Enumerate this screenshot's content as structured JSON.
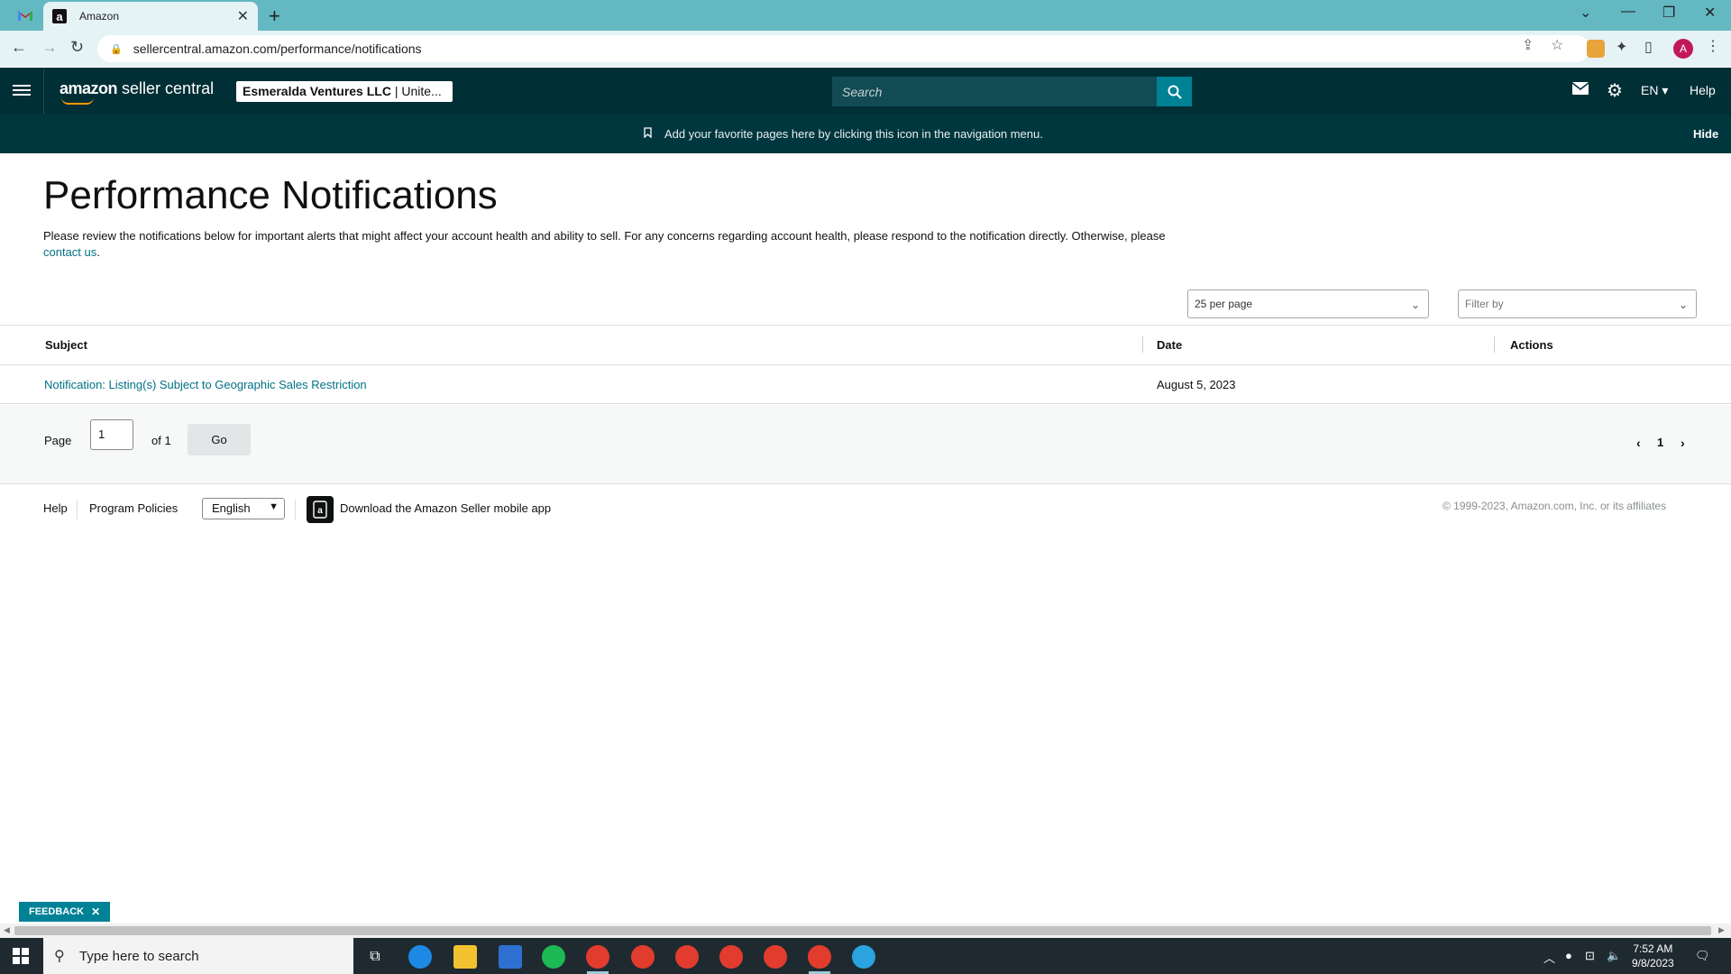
{
  "browser": {
    "tab_title": "Amazon",
    "tab_favicon_letter": "a",
    "url": "sellercentral.amazon.com/performance/notifications",
    "profile_initial": "A"
  },
  "header": {
    "logo_brand": "amazon",
    "logo_product": " seller central",
    "account_name": "Esmeralda Ventures LLC",
    "account_region": " | Unite...",
    "search_placeholder": "Search",
    "language": "EN",
    "help_label": "Help"
  },
  "favorites_bar": {
    "message": "Add your favorite pages here by clicking this icon in the navigation menu.",
    "hide_label": "Hide"
  },
  "main": {
    "title": "Performance Notifications",
    "description": "Please review the notifications below for important alerts that might affect your account health and ability to sell. For any concerns regarding account health, please respond to the notification directly. Otherwise, please ",
    "contact_link": "contact us",
    "description_end": ".",
    "per_page_select": "25 per page",
    "filter_select": "Filter by",
    "columns": {
      "subject": "Subject",
      "date": "Date",
      "actions": "Actions"
    },
    "rows": [
      {
        "subject": "Notification: Listing(s) Subject to Geographic Sales Restriction",
        "date": "August 5, 2023"
      }
    ],
    "pagination": {
      "page_label": "Page",
      "page_value": "1",
      "of_label": "of 1",
      "go_label": "Go",
      "current_page": "1"
    }
  },
  "footer": {
    "help": "Help",
    "program_policies": "Program Policies",
    "language": "English",
    "app_download": "Download the Amazon Seller mobile app",
    "copyright": "© 1999-2023, Amazon.com, Inc. or its affiliates"
  },
  "feedback_label": "FEEDBACK",
  "taskbar": {
    "search_placeholder": "Type here to search",
    "time": "7:52 AM",
    "date": "9/8/2023"
  },
  "colors": {
    "chrome_frame": "#64b8c2",
    "sc_header": "#002f36",
    "link": "#007185",
    "search_button": "#008296"
  }
}
